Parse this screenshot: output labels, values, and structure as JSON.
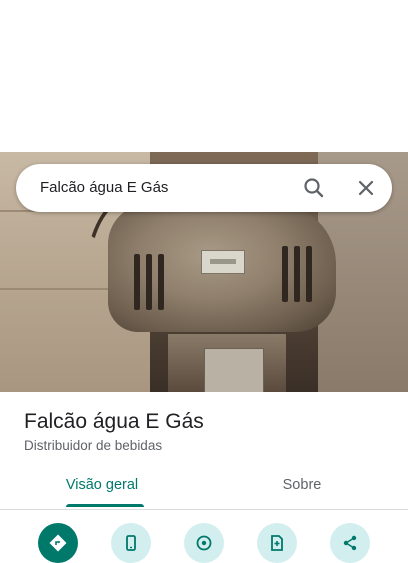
{
  "search": {
    "query": "Falcão água E Gás",
    "search_icon": "search-icon",
    "close_icon": "close-icon"
  },
  "place": {
    "name": "Falcão água E Gás",
    "category": "Distribuidor de bebidas"
  },
  "tabs": [
    {
      "label": "Visão geral",
      "selected": true
    },
    {
      "label": "Sobre",
      "selected": false
    }
  ],
  "actions": [
    {
      "icon": "directions-icon"
    },
    {
      "icon": "phone-icon"
    },
    {
      "icon": "location-icon"
    },
    {
      "icon": "save-icon"
    },
    {
      "icon": "share-icon"
    }
  ],
  "colors": {
    "accent": "#00796b",
    "action_bg": "#d2eeee",
    "title": "#202124",
    "secondary": "#5f6368"
  }
}
